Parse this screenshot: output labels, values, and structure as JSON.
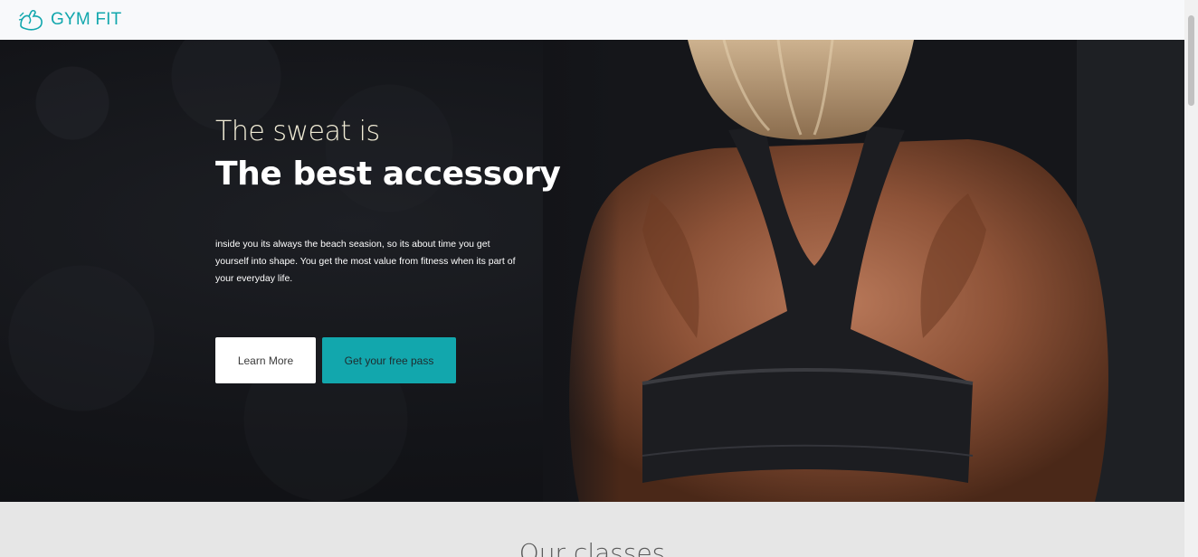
{
  "navbar": {
    "brand_name": "GYM FIT",
    "brand_icon": "flexed-arm-icon",
    "accent_color": "#12a7ad"
  },
  "hero": {
    "kicker": "The sweat is",
    "title": "The best accessory",
    "description": "inside you its always the beach seasion, so its about time you get yourself into shape. You get the most value from fitness when its part of your everyday life.",
    "learn_more_label": "Learn More",
    "free_pass_label": "Get your free pass"
  },
  "classes": {
    "title": "Our classes"
  }
}
